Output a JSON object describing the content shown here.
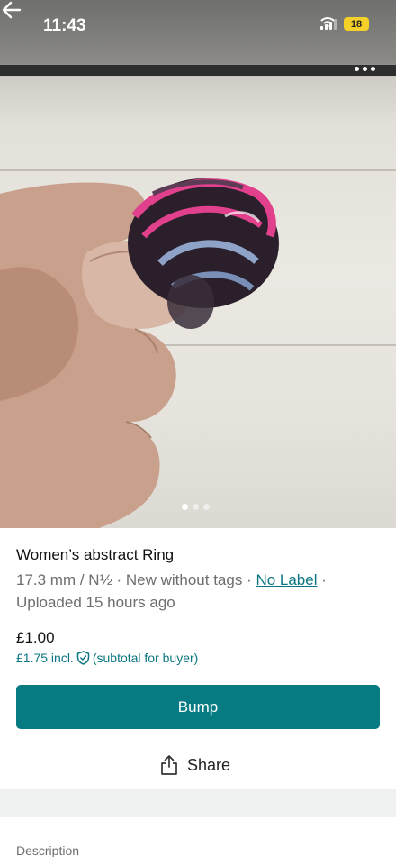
{
  "status_bar": {
    "time": "11:43",
    "battery": "18"
  },
  "gallery": {
    "image_alt": "Women's abstract ring held between fingers",
    "photo_count": 3,
    "active_index": 0
  },
  "listing": {
    "title": "Women’s abstract Ring",
    "size": "17.3 mm / N½",
    "separator": " · ",
    "condition": "New without tags",
    "brand": "No Label",
    "uploaded": "Uploaded 15 hours ago",
    "price": "£1.00",
    "price_incl": "£1.75 incl.",
    "price_incl_note": "(subtotal for buyer)"
  },
  "actions": {
    "bump_label": "Bump",
    "share_label": "Share"
  },
  "section": {
    "description_label": "Description"
  },
  "colors": {
    "accent": "#077b82",
    "link": "#0b7681",
    "battery": "#f4d028"
  }
}
